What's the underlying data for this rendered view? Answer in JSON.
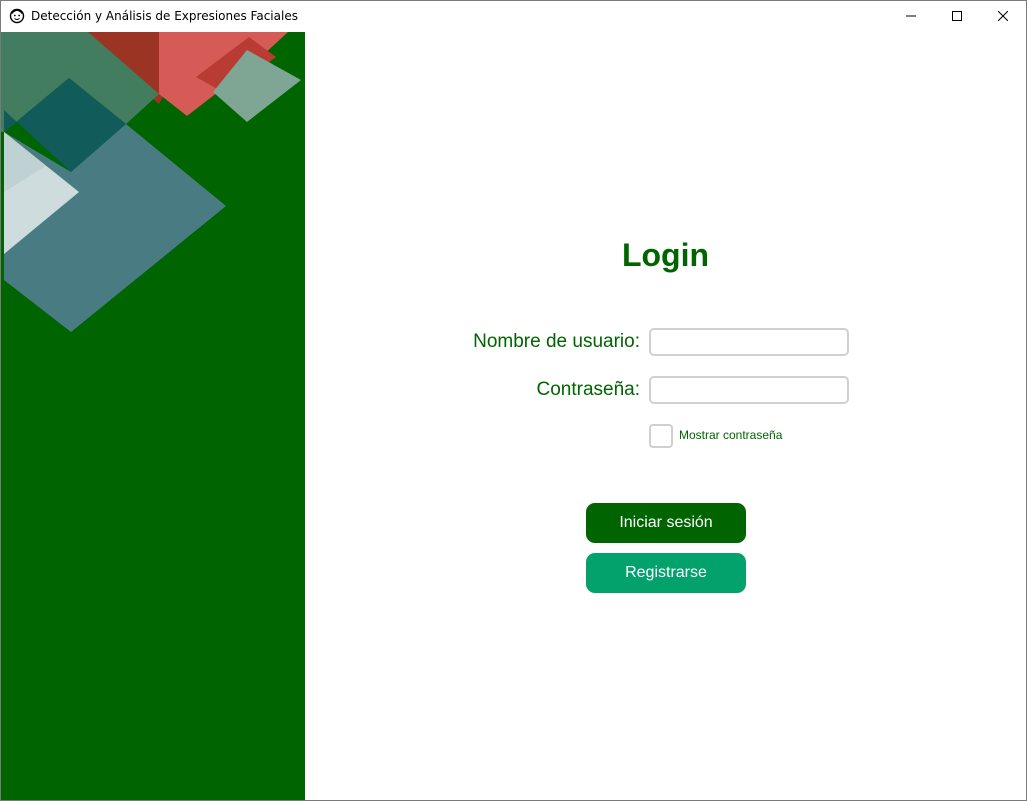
{
  "window": {
    "title": "Detección y Análisis de Expresiones Faciales"
  },
  "icons": {
    "app": "app-face-icon",
    "minimize": "minimize-icon",
    "maximize": "maximize-icon",
    "close": "close-icon"
  },
  "colors": {
    "brand_green": "#006400",
    "register_green": "#03a26c",
    "input_border": "#d0d0d0"
  },
  "login": {
    "title": "Login",
    "username_label": "Nombre de usuario:",
    "password_label": "Contraseña:",
    "username_value": "",
    "password_value": "",
    "show_password_label": "Mostrar contraseña",
    "show_password_checked": false,
    "login_button": "Iniciar sesión",
    "register_button": "Registrarse"
  }
}
